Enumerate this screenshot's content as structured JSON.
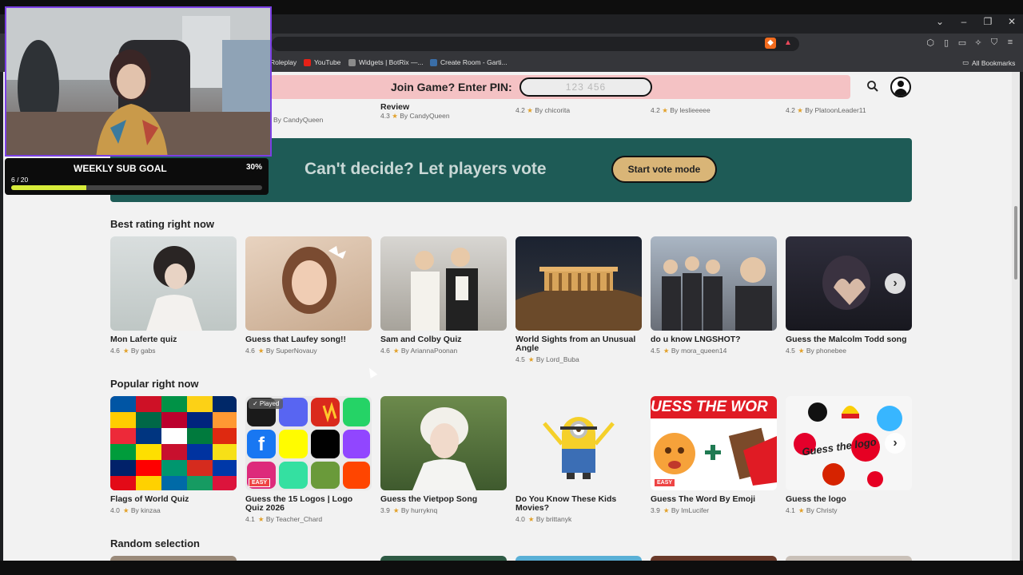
{
  "bookmarks": [
    {
      "label": "Roleplay",
      "color": "#5a5a5a"
    },
    {
      "label": "YouTube",
      "color": "#e62117"
    },
    {
      "label": "Widgets | BotRix —...",
      "color": "#8b8b8b"
    },
    {
      "label": "Create Room - Garti...",
      "color": "#3a6ea8"
    }
  ],
  "all_bookmarks": "All Bookmarks",
  "header": {
    "pin_label": "Join Game? Enter PIN:",
    "pin_placeholder": "123 456"
  },
  "top_row": [
    {
      "title": "",
      "rating": "",
      "author": "By CandyQueen"
    },
    {
      "title": "Review",
      "rating": "4.3",
      "author": "By CandyQueen"
    },
    {
      "title": "",
      "rating": "4.2",
      "author": "By chicorita"
    },
    {
      "title": "",
      "rating": "4.2",
      "author": "By leslieeeee"
    },
    {
      "title": "",
      "rating": "4.2",
      "author": "By PlatoonLeader11"
    }
  ],
  "vote": {
    "text": "Can't decide? Let players vote",
    "button": "Start vote mode"
  },
  "sections": {
    "best": "Best rating right now",
    "popular": "Popular right now",
    "random": "Random selection"
  },
  "best_cards": [
    {
      "title": "Mon Laferte quiz",
      "rating": "4.6",
      "author": "By gabs"
    },
    {
      "title": "Guess that Laufey song!!",
      "rating": "4.6",
      "author": "By SuperNovauy"
    },
    {
      "title": "Sam and Colby Quiz",
      "rating": "4.6",
      "author": "By AriannaPoonan"
    },
    {
      "title": "World Sights from an Unusual Angle",
      "rating": "4.5",
      "author": "By Lord_Buba"
    },
    {
      "title": "do u know LNGSHOT?",
      "rating": "4.5",
      "author": "By mora_queen14"
    },
    {
      "title": "Guess the Malcolm Todd song",
      "rating": "4.5",
      "author": "By phonebee"
    }
  ],
  "popular_cards": [
    {
      "title": "Flags of World Quiz",
      "rating": "4.0",
      "author": "By kinzaa"
    },
    {
      "title": "Guess the 15 Logos | Logo Quiz 2026",
      "rating": "4.1",
      "author": "By Teacher_Chard",
      "badge": "✓ Played",
      "easy": "EASY"
    },
    {
      "title": "Guess the Vietpop Song",
      "rating": "3.9",
      "author": "By hurryknq"
    },
    {
      "title": "Do You Know These Kids Movies?",
      "rating": "4.0",
      "author": "By brittanyk"
    },
    {
      "title": "Guess The Word By Emoji",
      "rating": "3.9",
      "author": "By ImLucifer",
      "banner": "UESS THE WOR",
      "easy": "EASY"
    },
    {
      "title": "Guess the logo",
      "rating": "4.1",
      "author": "By Christy",
      "overlay": "Guess the logo"
    }
  ],
  "goal": {
    "title": "WEEKLY SUB GOAL",
    "percent_label": "30%",
    "count": "6 / 20",
    "progress": 0.3
  },
  "colors": {
    "accent": "#1e5b56",
    "pin_bar": "#f4c2c4",
    "vote_button": "#d9b577",
    "star": "#e2a12a",
    "cam_border": "#7b3fe4"
  }
}
